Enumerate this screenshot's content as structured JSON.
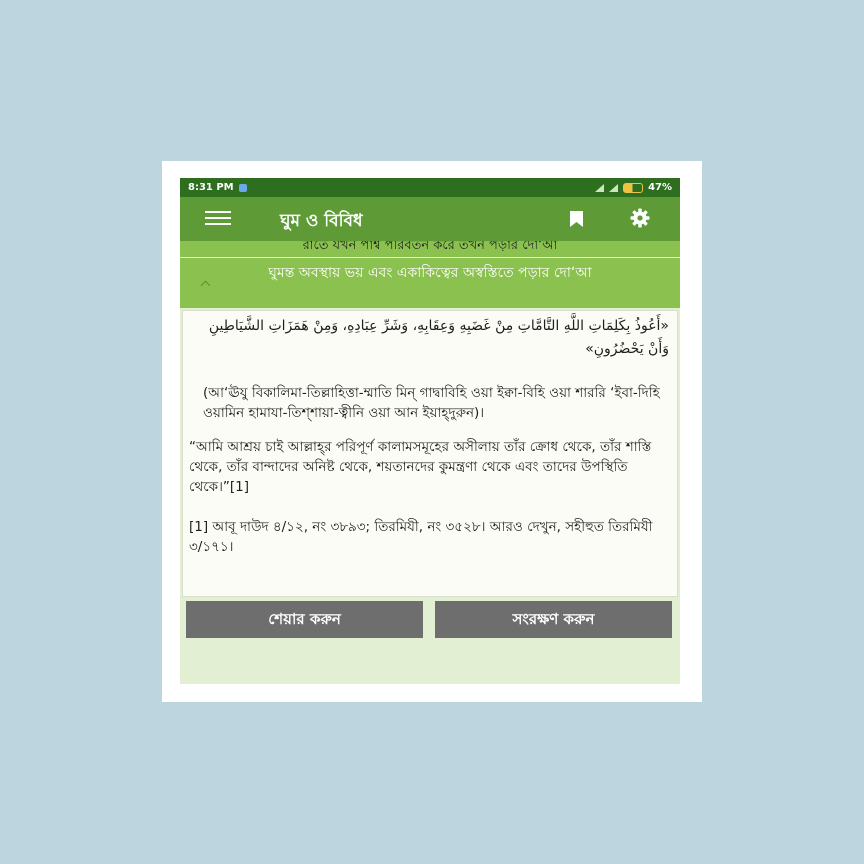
{
  "status_bar": {
    "time": "8:31 PM",
    "battery": "47%"
  },
  "toolbar": {
    "title": "ঘুম ও বিবিধ",
    "menu_icon": "hamburger-menu-icon",
    "bookmark_icon": "bookmark-icon",
    "settings_icon": "gear-icon"
  },
  "list": {
    "previous_item": "রাতে যখন পার্শ্ব পরিবর্তন করে তখন পড়ার দো‘আ",
    "current_item": "ঘুমন্ত অবস্থায় ভয় এবং একাকিত্বের অস্বস্তিতে পড়ার দো‘আ"
  },
  "dua": {
    "arabic": "«أَعُوذُ بِكَلِمَاتِ اللَّهِ التَّامَّاتِ مِنْ غَضَبِهِ وَعِقَابِهِ، وَشَرِّ عِبَادِهِ، وَمِنْ هَمَزَاتِ الشَّيَاطِينِ وَأَنْ يَحْضُرُونِ»",
    "transliteration": "(আ‘ঊযু বিকালিমা-তিল্লাহিত্তা-ম্মাতি মিন্ গাদ্বাবিহি ওয়া ইক্বা-বিহি ওয়া শাররি ‘ইবা-দিহি ওয়ামিন হামাযা-তিশ্শায়া-ত্বীনি ওয়া আন ইয়াহ্দুরুন)।",
    "meaning": "“আমি আশ্রয় চাই আল্লাহ্‌র পরিপূর্ণ কালামসমূহের অসীলায় তাঁর ক্রোধ থেকে, তাঁর শাস্তি থেকে, তাঁর বান্দাদের অনিষ্ট থেকে, শয়তানদের কুমন্ত্রণা থেকে এবং তাদের উপস্থিতি থেকে।”[1]",
    "footnote": "[1] আবূ দাউদ ৪/১২, নং ৩৮৯৩; তিরমিযী, নং ৩৫২৮। আরও দেখুন, সহীহুত তিরমিযী ৩/১৭১।"
  },
  "actions": {
    "share_label": "শেয়ার করুন",
    "save_label": "সংরক্ষণ করুন"
  },
  "colors": {
    "background": "#bcd5de",
    "status_bar": "#2d6e1f",
    "toolbar": "#5e9b36",
    "header": "#8bc24f",
    "button": "#6e6e6e"
  }
}
